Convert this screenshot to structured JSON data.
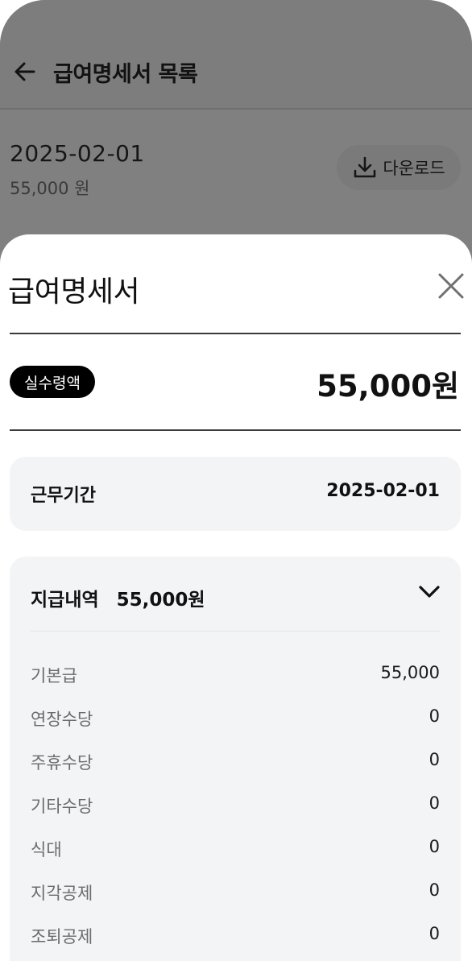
{
  "header": {
    "title": "급여명세서 목록"
  },
  "list": {
    "items": [
      {
        "date": "2025-02-01",
        "amount": "55,000 원",
        "download_label": "다운로드"
      }
    ]
  },
  "sheet": {
    "title": "급여명세서",
    "net_badge": "실수령액",
    "net_amount": "55,000원",
    "period": {
      "label": "근무기간",
      "value": "2025-02-01"
    },
    "payments": {
      "label": "지급내역",
      "total": "55,000원",
      "items": [
        {
          "label": "기본급",
          "value": "55,000"
        },
        {
          "label": "연장수당",
          "value": "0"
        },
        {
          "label": "주휴수당",
          "value": "0"
        },
        {
          "label": "기타수당",
          "value": "0"
        },
        {
          "label": "식대",
          "value": "0"
        },
        {
          "label": "지각공제",
          "value": "0"
        },
        {
          "label": "조퇴공제",
          "value": "0"
        }
      ]
    }
  },
  "icons": {
    "back": "arrow-left-icon",
    "download": "download-icon",
    "close": "close-icon",
    "expand": "chevron-down-icon"
  }
}
